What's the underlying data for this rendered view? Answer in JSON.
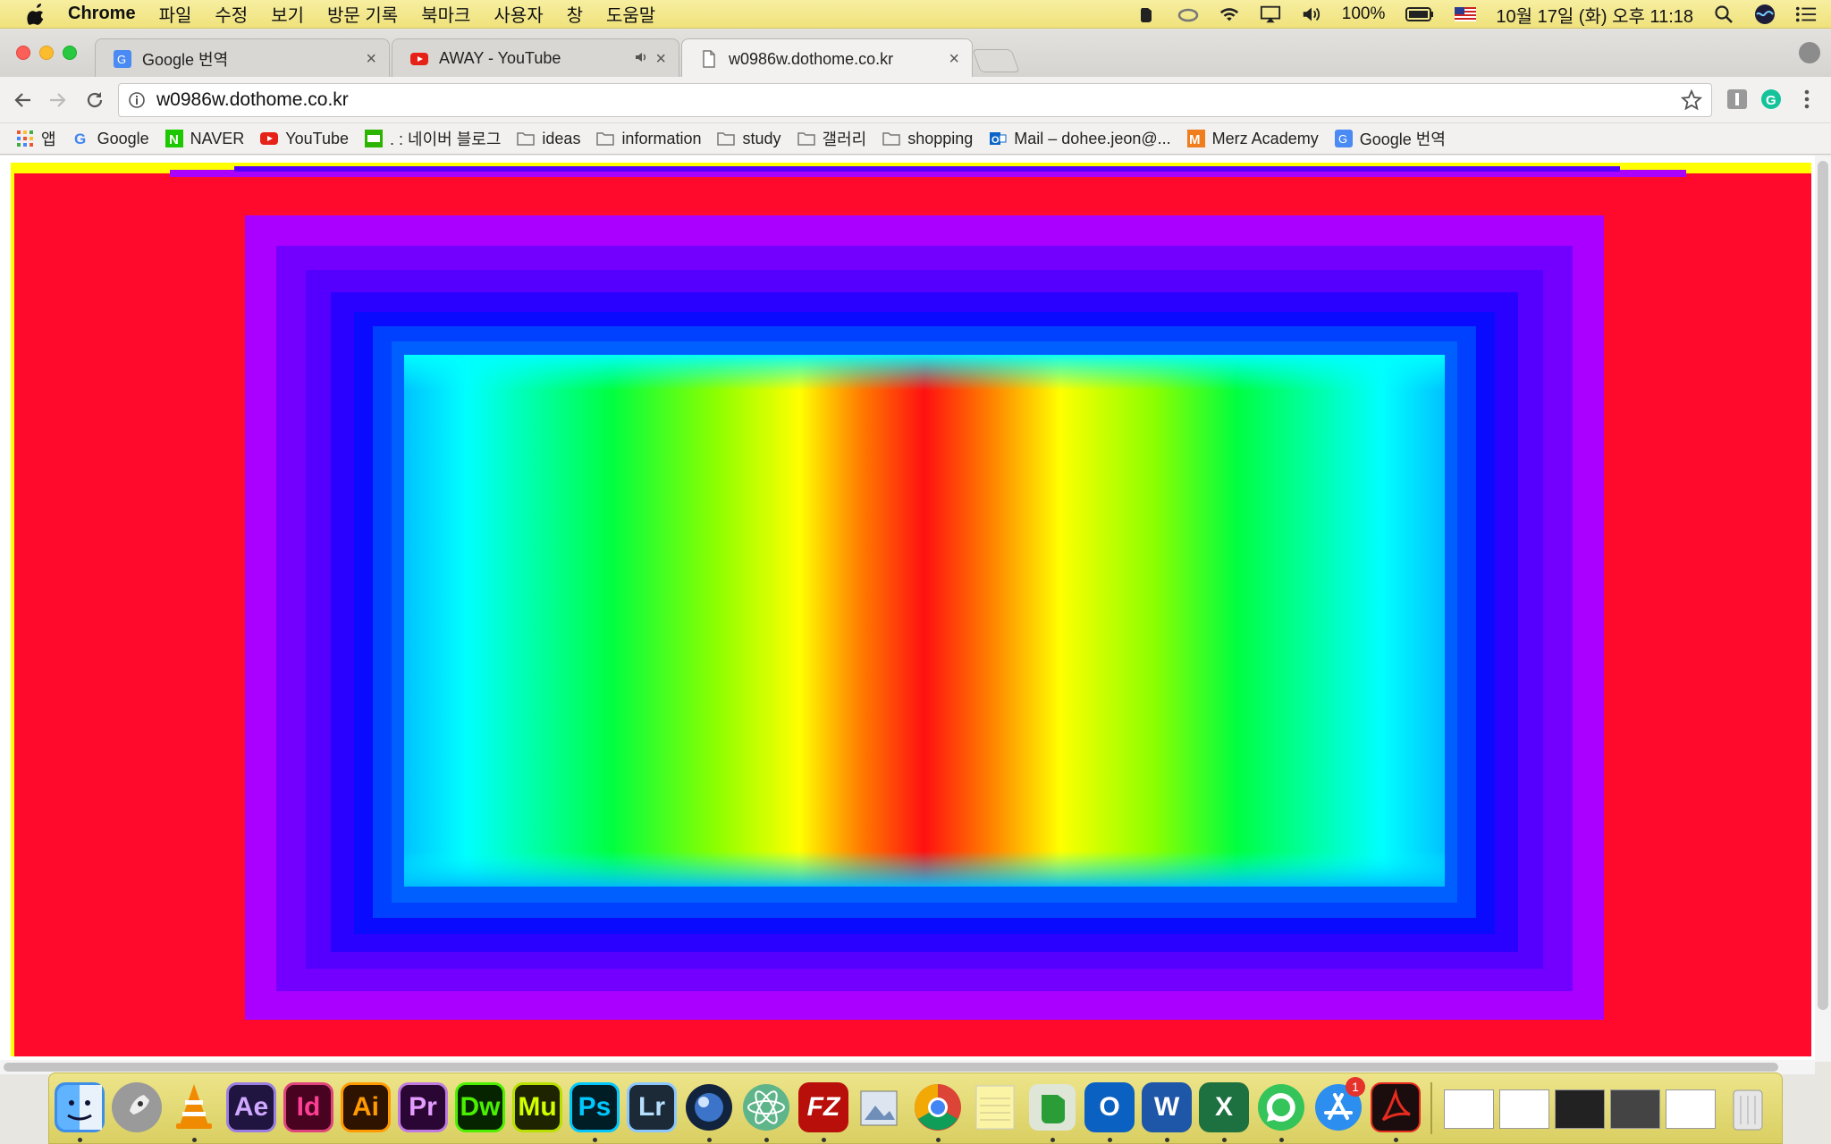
{
  "menubar": {
    "app_name": "Chrome",
    "menus": [
      "파일",
      "수정",
      "보기",
      "방문 기록",
      "북마크",
      "사용자",
      "창",
      "도움말"
    ],
    "battery": "100%",
    "clock": "10월 17일 (화) 오후 11:18"
  },
  "tabs": [
    {
      "title": "Google 번역",
      "icon": "google-translate-icon"
    },
    {
      "title": "AWAY - YouTube",
      "icon": "youtube-icon",
      "audio": true
    },
    {
      "title": "w0986w.dothome.co.kr",
      "icon": "page-icon",
      "active": true
    }
  ],
  "toolbar": {
    "url": "w0986w.dothome.co.kr"
  },
  "bookmarks": [
    {
      "label": "앱",
      "icon": "apps-grid-icon"
    },
    {
      "label": "Google",
      "icon": "google-icon"
    },
    {
      "label": "NAVER",
      "icon": "naver-icon"
    },
    {
      "label": "YouTube",
      "icon": "youtube-icon"
    },
    {
      "label": ". : 네이버 블로그",
      "icon": "blog-icon"
    },
    {
      "label": "ideas",
      "icon": "folder-icon"
    },
    {
      "label": "information",
      "icon": "folder-icon"
    },
    {
      "label": "study",
      "icon": "folder-icon"
    },
    {
      "label": "갤러리",
      "icon": "folder-icon"
    },
    {
      "label": "shopping",
      "icon": "folder-icon"
    },
    {
      "label": "Mail – dohee.jeon@...",
      "icon": "outlook-icon"
    },
    {
      "label": "Merz Academy",
      "icon": "merz-icon"
    },
    {
      "label": "Google 번역",
      "icon": "google-translate-icon"
    }
  ],
  "dock": {
    "apps": [
      {
        "name": "finder",
        "label": "",
        "bg": "#3d8ee8",
        "fg": "#fff"
      },
      {
        "name": "launchpad",
        "label": "",
        "bg": "#8d8d8d",
        "fg": "#fff"
      },
      {
        "name": "vlc",
        "label": "",
        "bg": "transparent",
        "fg": "#f08a00"
      },
      {
        "name": "after-effects",
        "label": "Ae",
        "bg": "#1f1540",
        "fg": "#cfa8ff"
      },
      {
        "name": "indesign",
        "label": "Id",
        "bg": "#49021f",
        "fg": "#ff3f94"
      },
      {
        "name": "illustrator",
        "label": "Ai",
        "bg": "#2e1300",
        "fg": "#ff9a00"
      },
      {
        "name": "premiere",
        "label": "Pr",
        "bg": "#2a0634",
        "fg": "#e49bff"
      },
      {
        "name": "dreamweaver",
        "label": "Dw",
        "bg": "#072401",
        "fg": "#4bf000"
      },
      {
        "name": "muse",
        "label": "Mu",
        "bg": "#1f2400",
        "fg": "#d0ff00"
      },
      {
        "name": "photoshop",
        "label": "Ps",
        "bg": "#001d26",
        "fg": "#00c8ff"
      },
      {
        "name": "lightroom",
        "label": "Lr",
        "bg": "#1c2a38",
        "fg": "#b7e0ff"
      },
      {
        "name": "cinema4d",
        "label": "",
        "bg": "#12233d",
        "fg": "#fff"
      },
      {
        "name": "atom",
        "label": "",
        "bg": "#5fb58a",
        "fg": "#fff"
      },
      {
        "name": "filezilla",
        "label": "FZ",
        "bg": "#b80f0a",
        "fg": "#fff"
      },
      {
        "name": "preview",
        "label": "",
        "bg": "#6f8fb8",
        "fg": "#fff"
      },
      {
        "name": "chrome",
        "label": "",
        "bg": "#e8e8e8",
        "fg": "#fff"
      },
      {
        "name": "notes",
        "label": "",
        "bg": "#fbf4a4",
        "fg": "#333"
      },
      {
        "name": "evernote",
        "label": "",
        "bg": "#2b9d36",
        "fg": "#fff"
      },
      {
        "name": "outlook",
        "label": "O",
        "bg": "#0b61c2",
        "fg": "#fff"
      },
      {
        "name": "word",
        "label": "W",
        "bg": "#1e56a8",
        "fg": "#fff"
      },
      {
        "name": "excel",
        "label": "X",
        "bg": "#1d7140",
        "fg": "#fff"
      },
      {
        "name": "whatsapp",
        "label": "",
        "bg": "#34c45a",
        "fg": "#fff"
      },
      {
        "name": "app-store",
        "label": "",
        "bg": "#2c8fef",
        "fg": "#fff"
      },
      {
        "name": "acrobat",
        "label": "",
        "bg": "#1b0d0d",
        "fg": "#e62b1e"
      }
    ],
    "app_store_badge": "1"
  }
}
